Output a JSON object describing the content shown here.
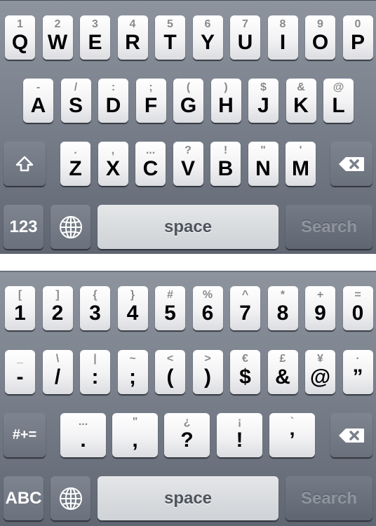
{
  "keyboard_letters": {
    "row1": [
      {
        "main": "Q",
        "sub": "1"
      },
      {
        "main": "W",
        "sub": "2"
      },
      {
        "main": "E",
        "sub": "3"
      },
      {
        "main": "R",
        "sub": "4"
      },
      {
        "main": "T",
        "sub": "5"
      },
      {
        "main": "Y",
        "sub": "6"
      },
      {
        "main": "U",
        "sub": "7"
      },
      {
        "main": "I",
        "sub": "8"
      },
      {
        "main": "O",
        "sub": "9"
      },
      {
        "main": "P",
        "sub": "0"
      }
    ],
    "row2": [
      {
        "main": "A",
        "sub": "-"
      },
      {
        "main": "S",
        "sub": "/"
      },
      {
        "main": "D",
        "sub": ":"
      },
      {
        "main": "F",
        "sub": ";"
      },
      {
        "main": "G",
        "sub": "("
      },
      {
        "main": "H",
        "sub": ")"
      },
      {
        "main": "J",
        "sub": "$"
      },
      {
        "main": "K",
        "sub": "&"
      },
      {
        "main": "L",
        "sub": "@"
      }
    ],
    "row3": [
      {
        "main": "Z",
        "sub": "."
      },
      {
        "main": "X",
        "sub": ","
      },
      {
        "main": "C",
        "sub": "..."
      },
      {
        "main": "V",
        "sub": "?"
      },
      {
        "main": "B",
        "sub": "!"
      },
      {
        "main": "N",
        "sub": "\""
      },
      {
        "main": "M",
        "sub": "'"
      }
    ],
    "shift_icon": "shift-arrow-icon",
    "delete_icon": "backspace-icon",
    "mode_label": "123",
    "globe_icon": "globe-icon",
    "space_label": "space",
    "action_label": "Search"
  },
  "keyboard_symbols": {
    "row1": [
      {
        "main": "1",
        "sub": "["
      },
      {
        "main": "2",
        "sub": "]"
      },
      {
        "main": "3",
        "sub": "{"
      },
      {
        "main": "4",
        "sub": "}"
      },
      {
        "main": "5",
        "sub": "#"
      },
      {
        "main": "6",
        "sub": "%"
      },
      {
        "main": "7",
        "sub": "^"
      },
      {
        "main": "8",
        "sub": "*"
      },
      {
        "main": "9",
        "sub": "+"
      },
      {
        "main": "0",
        "sub": "="
      }
    ],
    "row2": [
      {
        "main": "-",
        "sub": "_"
      },
      {
        "main": "/",
        "sub": "\\"
      },
      {
        "main": ":",
        "sub": "|"
      },
      {
        "main": ";",
        "sub": "~"
      },
      {
        "main": "(",
        "sub": "<"
      },
      {
        "main": ")",
        "sub": ">"
      },
      {
        "main": "$",
        "sub": "€"
      },
      {
        "main": "&",
        "sub": "£"
      },
      {
        "main": "@",
        "sub": "¥"
      },
      {
        "main": "”",
        "sub": "·"
      }
    ],
    "row3": [
      {
        "main": ".",
        "sub": "..."
      },
      {
        "main": ",",
        "sub": "\""
      },
      {
        "main": "?",
        "sub": "¿"
      },
      {
        "main": "!",
        "sub": "¡"
      },
      {
        "main": "’",
        "sub": "`"
      }
    ],
    "more_label": "#+=",
    "delete_icon": "backspace-icon",
    "mode_label": "ABC",
    "globe_icon": "globe-icon",
    "space_label": "space",
    "action_label": "Search"
  }
}
